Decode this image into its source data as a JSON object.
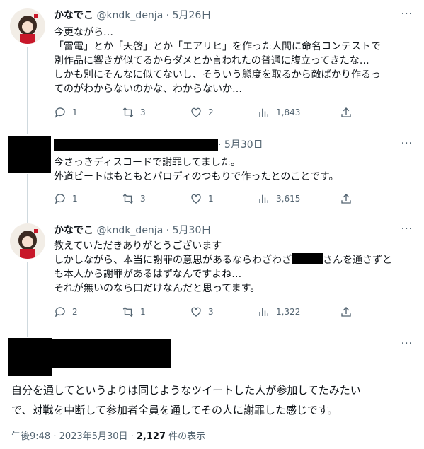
{
  "tweets": [
    {
      "name": "かなでこ",
      "handle": "@kndk_denja",
      "sep": "·",
      "date": "5月26日",
      "lines": [
        "今更ながら…",
        "「雷電」とか「天啓」とか「エアリヒ」を作った人間に命名コンテストで",
        "別作品に響きが似てるからダメとか言われたの普通に腹立ってきたな…",
        "しかも別にそんなに似てないし、そういう態度を取るから敵ばかり作るっ",
        "てのがわからないのかな、わからないか…"
      ],
      "replies": "1",
      "retweets": "3",
      "likes": "2",
      "views": "1,843"
    },
    {
      "sep": "·",
      "date": "5月30日",
      "lines": [
        "今さっきディスコードで謝罪してました。",
        "外道ビートはもともとパロディのつもりで作ったとのことです。"
      ],
      "replies": "1",
      "retweets": "3",
      "likes": "1",
      "views": "3,615"
    },
    {
      "name": "かなでこ",
      "handle": "@kndk_denja",
      "sep": "·",
      "date": "5月30日",
      "lines": [
        "教えていただきありがとうございます",
        "しかしながら、本当に謝罪の意思があるならわざわざ",
        "も本人から謝罪があるはずなんですよね…",
        "それが無いのなら口だけなんだと思ってます。"
      ],
      "line2_suffix": "さんを通さずと",
      "replies": "2",
      "retweets": "1",
      "likes": "3",
      "views": "1,322"
    }
  ],
  "main": {
    "lines": [
      "自分を通してというよりは同じようなツイートした人が参加してたみたい",
      "で、対戦を中断して参加者全員を通してその人に謝罪した感じです。"
    ],
    "time": "午後9:48 · 2023年5月30日 · ",
    "views": "2,127",
    "views_suffix": " 件の表示"
  },
  "more_label": "···",
  "colors": {
    "text": "#0f1419",
    "secondary": "#536471",
    "line": "#cfd9de"
  },
  "icons": [
    "reply-icon",
    "retweet-icon",
    "like-icon",
    "views-icon",
    "share-icon",
    "more-icon"
  ]
}
